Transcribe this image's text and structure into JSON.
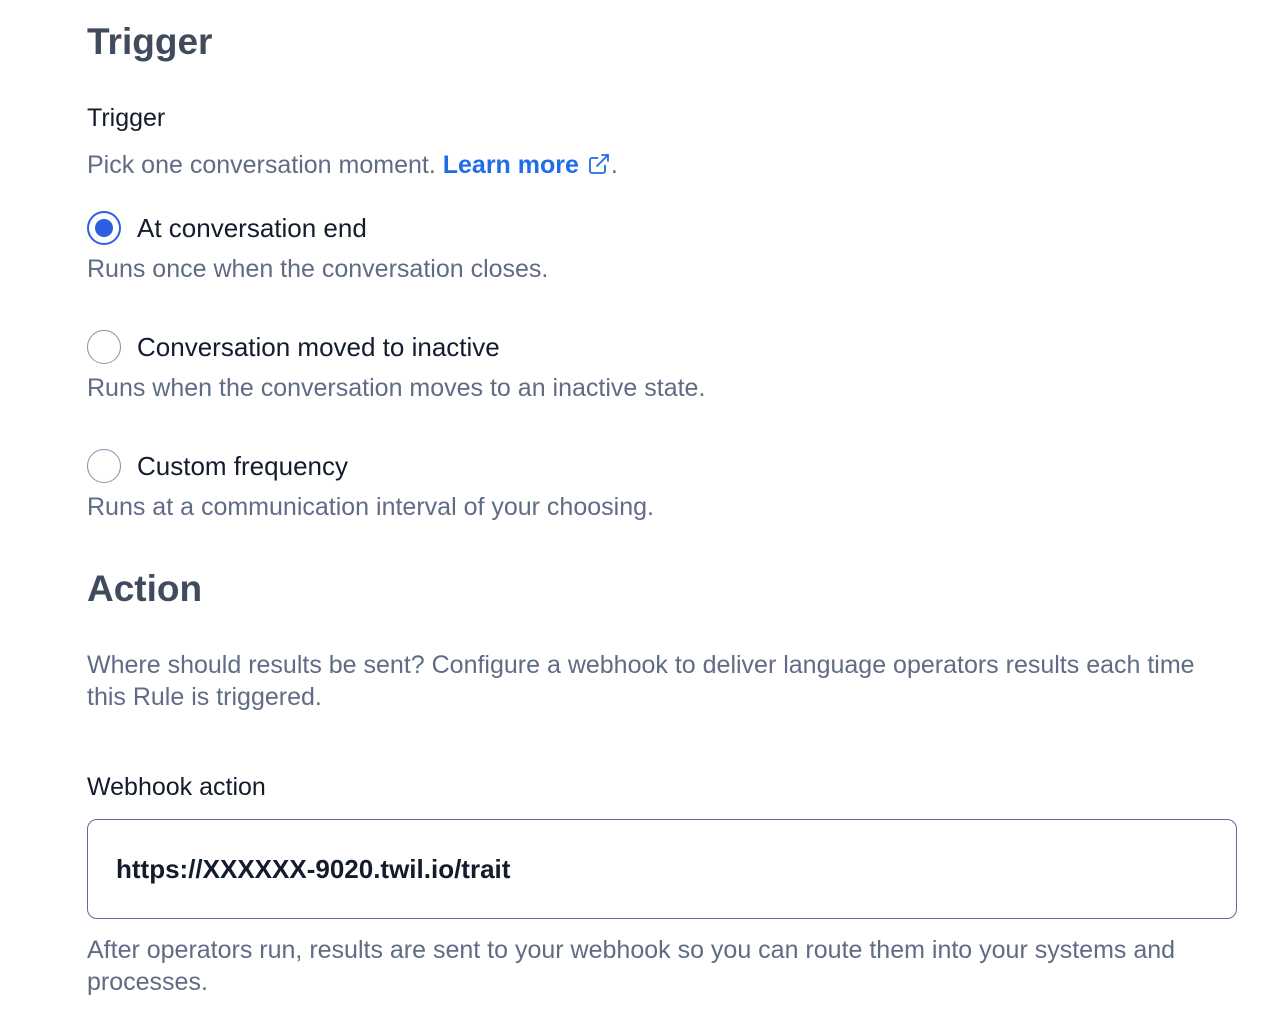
{
  "trigger": {
    "heading": "Trigger",
    "label": "Trigger",
    "help_prefix": "Pick one conversation moment. ",
    "learn_more": "Learn more",
    "help_suffix": ".",
    "options": [
      {
        "label": "At conversation end",
        "description": "Runs once when the conversation closes.",
        "checked": true
      },
      {
        "label": "Conversation moved to inactive",
        "description": "Runs when the conversation moves to an inactive state.",
        "checked": false
      },
      {
        "label": "Custom frequency",
        "description": "Runs at a communication interval of your choosing.",
        "checked": false
      }
    ]
  },
  "action": {
    "heading": "Action",
    "description": "Where should results be sent? Configure a webhook to deliver language operators results each time this Rule is triggered.",
    "webhook_label": "Webhook action",
    "webhook_value": "https://XXXXXX-9020.twil.io/trait",
    "webhook_help": "After operators run, results are sent to your webhook so you can route them into your systems and processes."
  },
  "colors": {
    "accent": "#2f5fe0",
    "link": "#1f6ce6",
    "heading": "#414b5e",
    "help_text": "#606b85"
  },
  "icons": {
    "learn_more": "external-link-icon"
  }
}
